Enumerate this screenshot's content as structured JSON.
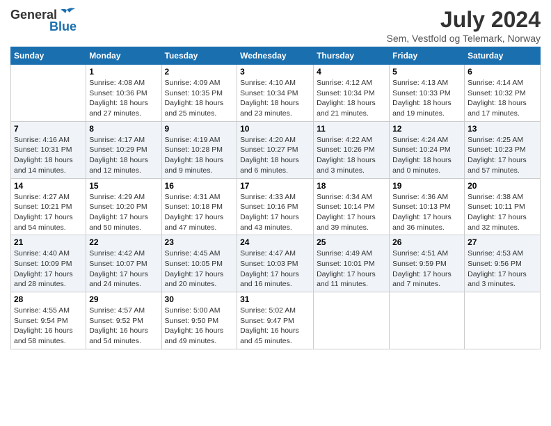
{
  "header": {
    "logo_general": "General",
    "logo_blue": "Blue",
    "main_title": "July 2024",
    "subtitle": "Sem, Vestfold og Telemark, Norway"
  },
  "days_of_week": [
    "Sunday",
    "Monday",
    "Tuesday",
    "Wednesday",
    "Thursday",
    "Friday",
    "Saturday"
  ],
  "weeks": [
    [
      {
        "day": "",
        "info": ""
      },
      {
        "day": "1",
        "info": "Sunrise: 4:08 AM\nSunset: 10:36 PM\nDaylight: 18 hours\nand 27 minutes."
      },
      {
        "day": "2",
        "info": "Sunrise: 4:09 AM\nSunset: 10:35 PM\nDaylight: 18 hours\nand 25 minutes."
      },
      {
        "day": "3",
        "info": "Sunrise: 4:10 AM\nSunset: 10:34 PM\nDaylight: 18 hours\nand 23 minutes."
      },
      {
        "day": "4",
        "info": "Sunrise: 4:12 AM\nSunset: 10:34 PM\nDaylight: 18 hours\nand 21 minutes."
      },
      {
        "day": "5",
        "info": "Sunrise: 4:13 AM\nSunset: 10:33 PM\nDaylight: 18 hours\nand 19 minutes."
      },
      {
        "day": "6",
        "info": "Sunrise: 4:14 AM\nSunset: 10:32 PM\nDaylight: 18 hours\nand 17 minutes."
      }
    ],
    [
      {
        "day": "7",
        "info": "Sunrise: 4:16 AM\nSunset: 10:31 PM\nDaylight: 18 hours\nand 14 minutes."
      },
      {
        "day": "8",
        "info": "Sunrise: 4:17 AM\nSunset: 10:29 PM\nDaylight: 18 hours\nand 12 minutes."
      },
      {
        "day": "9",
        "info": "Sunrise: 4:19 AM\nSunset: 10:28 PM\nDaylight: 18 hours\nand 9 minutes."
      },
      {
        "day": "10",
        "info": "Sunrise: 4:20 AM\nSunset: 10:27 PM\nDaylight: 18 hours\nand 6 minutes."
      },
      {
        "day": "11",
        "info": "Sunrise: 4:22 AM\nSunset: 10:26 PM\nDaylight: 18 hours\nand 3 minutes."
      },
      {
        "day": "12",
        "info": "Sunrise: 4:24 AM\nSunset: 10:24 PM\nDaylight: 18 hours\nand 0 minutes."
      },
      {
        "day": "13",
        "info": "Sunrise: 4:25 AM\nSunset: 10:23 PM\nDaylight: 17 hours\nand 57 minutes."
      }
    ],
    [
      {
        "day": "14",
        "info": "Sunrise: 4:27 AM\nSunset: 10:21 PM\nDaylight: 17 hours\nand 54 minutes."
      },
      {
        "day": "15",
        "info": "Sunrise: 4:29 AM\nSunset: 10:20 PM\nDaylight: 17 hours\nand 50 minutes."
      },
      {
        "day": "16",
        "info": "Sunrise: 4:31 AM\nSunset: 10:18 PM\nDaylight: 17 hours\nand 47 minutes."
      },
      {
        "day": "17",
        "info": "Sunrise: 4:33 AM\nSunset: 10:16 PM\nDaylight: 17 hours\nand 43 minutes."
      },
      {
        "day": "18",
        "info": "Sunrise: 4:34 AM\nSunset: 10:14 PM\nDaylight: 17 hours\nand 39 minutes."
      },
      {
        "day": "19",
        "info": "Sunrise: 4:36 AM\nSunset: 10:13 PM\nDaylight: 17 hours\nand 36 minutes."
      },
      {
        "day": "20",
        "info": "Sunrise: 4:38 AM\nSunset: 10:11 PM\nDaylight: 17 hours\nand 32 minutes."
      }
    ],
    [
      {
        "day": "21",
        "info": "Sunrise: 4:40 AM\nSunset: 10:09 PM\nDaylight: 17 hours\nand 28 minutes."
      },
      {
        "day": "22",
        "info": "Sunrise: 4:42 AM\nSunset: 10:07 PM\nDaylight: 17 hours\nand 24 minutes."
      },
      {
        "day": "23",
        "info": "Sunrise: 4:45 AM\nSunset: 10:05 PM\nDaylight: 17 hours\nand 20 minutes."
      },
      {
        "day": "24",
        "info": "Sunrise: 4:47 AM\nSunset: 10:03 PM\nDaylight: 17 hours\nand 16 minutes."
      },
      {
        "day": "25",
        "info": "Sunrise: 4:49 AM\nSunset: 10:01 PM\nDaylight: 17 hours\nand 11 minutes."
      },
      {
        "day": "26",
        "info": "Sunrise: 4:51 AM\nSunset: 9:59 PM\nDaylight: 17 hours\nand 7 minutes."
      },
      {
        "day": "27",
        "info": "Sunrise: 4:53 AM\nSunset: 9:56 PM\nDaylight: 17 hours\nand 3 minutes."
      }
    ],
    [
      {
        "day": "28",
        "info": "Sunrise: 4:55 AM\nSunset: 9:54 PM\nDaylight: 16 hours\nand 58 minutes."
      },
      {
        "day": "29",
        "info": "Sunrise: 4:57 AM\nSunset: 9:52 PM\nDaylight: 16 hours\nand 54 minutes."
      },
      {
        "day": "30",
        "info": "Sunrise: 5:00 AM\nSunset: 9:50 PM\nDaylight: 16 hours\nand 49 minutes."
      },
      {
        "day": "31",
        "info": "Sunrise: 5:02 AM\nSunset: 9:47 PM\nDaylight: 16 hours\nand 45 minutes."
      },
      {
        "day": "",
        "info": ""
      },
      {
        "day": "",
        "info": ""
      },
      {
        "day": "",
        "info": ""
      }
    ]
  ]
}
